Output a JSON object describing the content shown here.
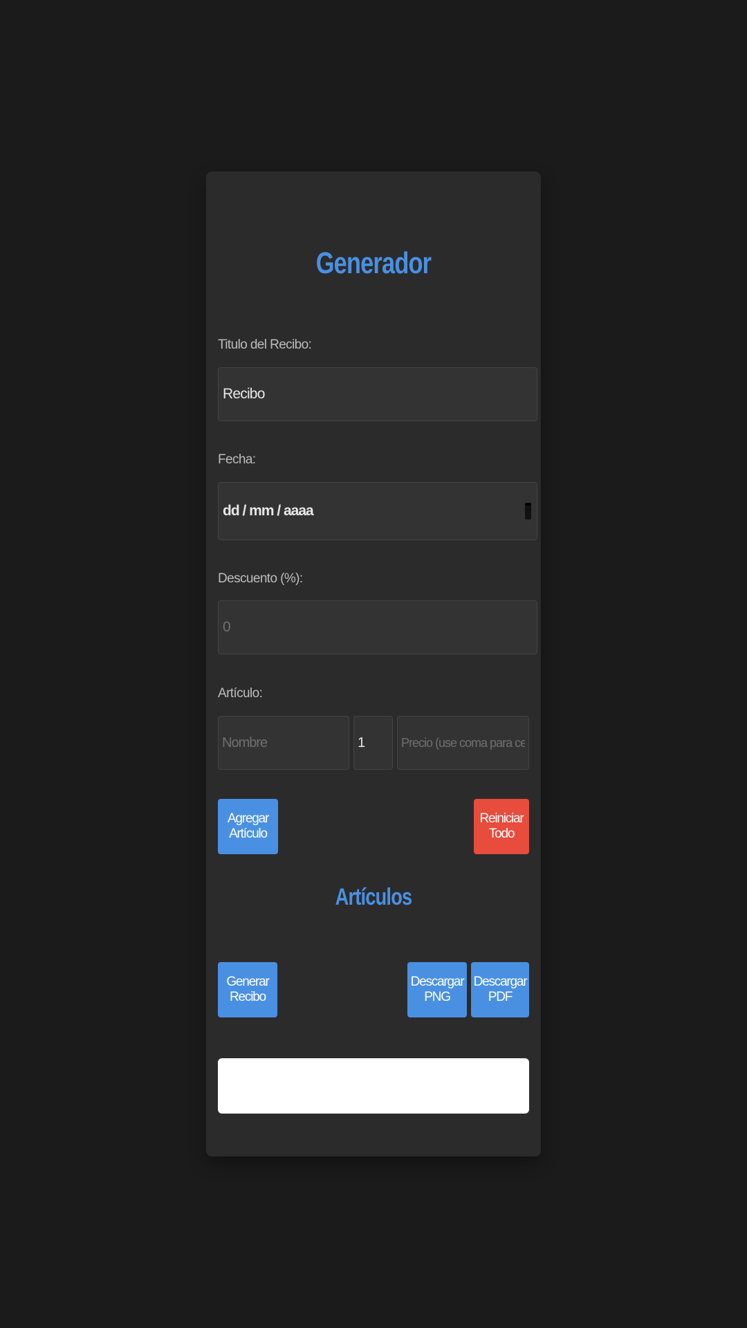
{
  "app": {
    "title": "Generador"
  },
  "form": {
    "title_label": "Titulo del Recibo:",
    "title_value": "Recibo",
    "date_label": "Fecha:",
    "date_placeholder": "dd / mm / aaaa",
    "discount_label": "Descuento (%):",
    "discount_placeholder": "0",
    "item_label": "Artículo:",
    "item_name_placeholder": "Nombre",
    "item_qty_value": "1",
    "item_price_placeholder": "Precio (use coma para centavos)"
  },
  "buttons": {
    "add_item": "Agregar Artículo",
    "reset_all": "Reiniciar Todo",
    "generate": "Generar Recibo",
    "download_png": "Descargar PNG",
    "download_pdf": "Descargar PDF"
  },
  "items_section": {
    "title": "Artículos"
  },
  "colors": {
    "background": "#1b1b1b",
    "card": "#2b2b2b",
    "accent": "#4a90e2",
    "danger": "#e74c3c"
  },
  "icons": {
    "date_picker": "calendar-icon"
  }
}
